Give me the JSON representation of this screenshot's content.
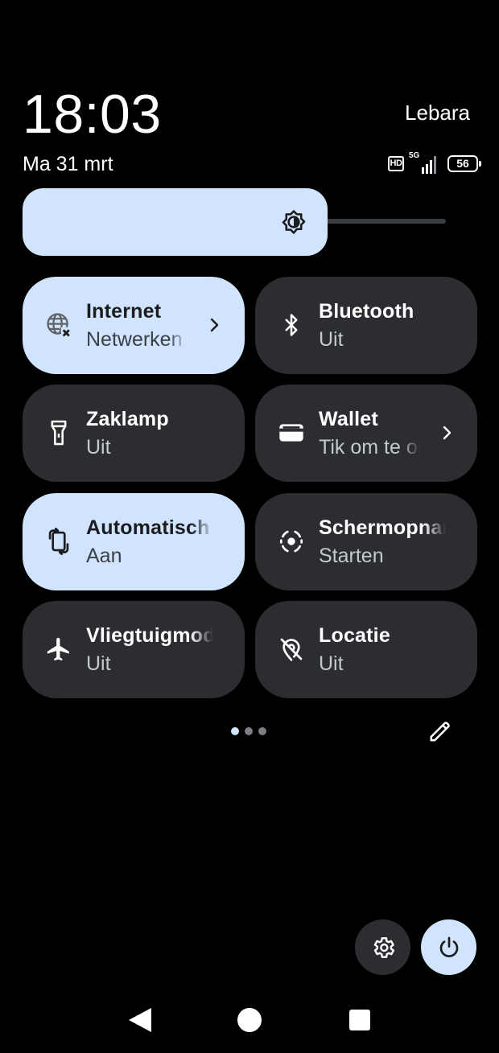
{
  "status": {
    "time": "18:03",
    "carrier": "Lebara",
    "date": "Ma 31 mrt",
    "hd_label": "HD",
    "network_label": "5G",
    "battery_level": "56"
  },
  "brightness": {
    "level": 0.72
  },
  "tiles": [
    {
      "title": "Internet",
      "subtitle": "Netwerken",
      "state": "on",
      "icon": "globe-no-internet-icon",
      "chevron": true
    },
    {
      "title": "Bluetooth",
      "subtitle": "Uit",
      "state": "off",
      "icon": "bluetooth-icon",
      "chevron": false
    },
    {
      "title": "Zaklamp",
      "subtitle": "Uit",
      "state": "off",
      "icon": "flashlight-icon",
      "chevron": false
    },
    {
      "title": "Wallet",
      "subtitle": "Tik om te openen",
      "state": "off",
      "icon": "wallet-icon",
      "chevron": true
    },
    {
      "title": "Automatisch draaien",
      "subtitle": "Aan",
      "state": "on",
      "icon": "auto-rotate-icon",
      "chevron": false
    },
    {
      "title": "Schermopname",
      "subtitle": "Starten",
      "state": "off",
      "icon": "screen-record-icon",
      "chevron": false
    },
    {
      "title": "Vliegtuigmodus",
      "subtitle": "Uit",
      "state": "off",
      "icon": "airplane-icon",
      "chevron": false
    },
    {
      "title": "Locatie",
      "subtitle": "Uit",
      "state": "off",
      "icon": "location-off-icon",
      "chevron": false
    }
  ],
  "pagination": {
    "pages": 3,
    "current": 1
  },
  "colors": {
    "accent": "#d1e4fd",
    "tile_off": "#2b2d31",
    "background": "#000000"
  }
}
